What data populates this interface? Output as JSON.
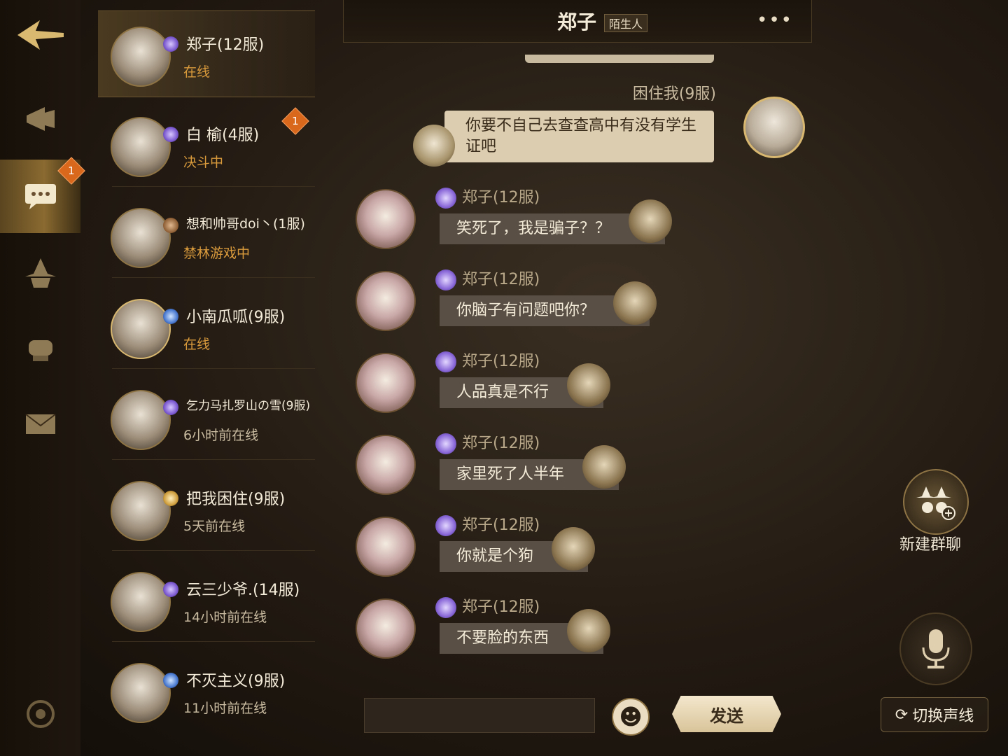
{
  "rail": {
    "back_icon": "back-arrow-icon",
    "chat_badge": "1"
  },
  "contacts": [
    {
      "name": "郑子(12服)",
      "status": "在线",
      "status_color": "#d99a3c",
      "badge": ""
    },
    {
      "name": "白 榆(4服)",
      "status": "决斗中",
      "status_color": "#d99a3c",
      "badge": "1"
    },
    {
      "name": "想和帅哥doi丶(1服)",
      "status": "禁林游戏中",
      "status_color": "#d99a3c",
      "badge": ""
    },
    {
      "name": "小南瓜呱(9服)",
      "status": "在线",
      "status_color": "#d99a3c",
      "badge": ""
    },
    {
      "name": "乞力马扎罗山の雪(9服)",
      "status": "6小时前在线",
      "status_color": "#c9bba0",
      "badge": ""
    },
    {
      "name": "把我困住(9服)",
      "status": "5天前在线",
      "status_color": "#c9bba0",
      "badge": ""
    },
    {
      "name": "云三少爷.(14服)",
      "status": "14小时前在线",
      "status_color": "#c9bba0",
      "badge": ""
    },
    {
      "name": "不灭主义(9服)",
      "status": "11小时前在线",
      "status_color": "#c9bba0",
      "badge": ""
    }
  ],
  "chat": {
    "title": "郑子",
    "tag": "陌生人",
    "outgoing": {
      "sender": "困住我(9服)",
      "text": "你要不自己去查查高中有没有学生证吧"
    },
    "incoming": [
      {
        "sender": "郑子(12服)",
        "text": "笑死了，我是骗子？？"
      },
      {
        "sender": "郑子(12服)",
        "text": "你脑子有问题吧你？"
      },
      {
        "sender": "郑子(12服)",
        "text": "人品真是不行"
      },
      {
        "sender": "郑子(12服)",
        "text": "家里死了人半年"
      },
      {
        "sender": "郑子(12服)",
        "text": "你就是个狗"
      },
      {
        "sender": "郑子(12服)",
        "text": "不要脸的东西"
      }
    ],
    "input_value": "",
    "send_label": "发送"
  },
  "tools": {
    "new_group_label": "新建群聊",
    "switch_voice_label": "切换声线"
  }
}
